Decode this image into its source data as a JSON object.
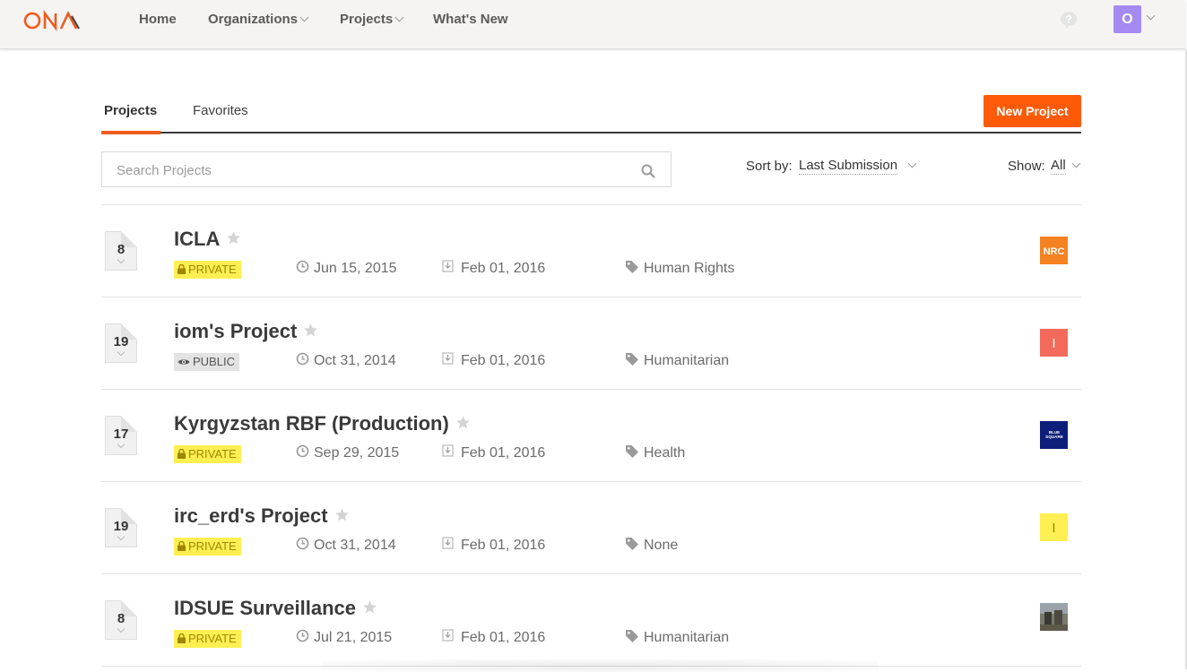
{
  "nav": {
    "items": [
      {
        "label": "Home",
        "has_dropdown": false
      },
      {
        "label": "Organizations",
        "has_dropdown": true
      },
      {
        "label": "Projects",
        "has_dropdown": true
      },
      {
        "label": "What's New",
        "has_dropdown": false
      }
    ],
    "avatar_initial": "O",
    "logo_color": "#f05b1f",
    "avatar_color": "#a48af2"
  },
  "tabs": [
    {
      "label": "Projects",
      "active": true
    },
    {
      "label": "Favorites",
      "active": false
    }
  ],
  "new_project_label": "New Project",
  "search": {
    "placeholder": "Search Projects"
  },
  "sort": {
    "label": "Sort by:",
    "value": "Last Submission"
  },
  "show": {
    "label": "Show:",
    "value": "All"
  },
  "projects": [
    {
      "count": "8",
      "title": "ICLA",
      "visibility": "PRIVATE",
      "created": "Jun 15, 2015",
      "last_submission": "Feb 01, 2016",
      "tag": "Human Rights",
      "org_logo": "NRC",
      "org_color": "#f58220"
    },
    {
      "count": "19",
      "title": "iom's Project",
      "visibility": "PUBLIC",
      "created": "Oct 31, 2014",
      "last_submission": "Feb 01, 2016",
      "tag": "Humanitarian",
      "org_logo": "I",
      "org_color": "#f36a5a"
    },
    {
      "count": "17",
      "title": "Kyrgyzstan RBF (Production)",
      "visibility": "PRIVATE",
      "created": "Sep 29, 2015",
      "last_submission": "Feb 01, 2016",
      "tag": "Health",
      "org_logo": "BLUE SQUARE",
      "org_color": "#0d1f7a"
    },
    {
      "count": "19",
      "title": "irc_erd's Project",
      "visibility": "PRIVATE",
      "created": "Oct 31, 2014",
      "last_submission": "Feb 01, 2016",
      "tag": "None",
      "org_logo": "I",
      "org_color": "#ffef52"
    },
    {
      "count": "8",
      "title": "IDSUE Surveillance",
      "visibility": "PRIVATE",
      "created": "Jul 21, 2015",
      "last_submission": "Feb 01, 2016",
      "tag": "Humanitarian",
      "org_logo": "photo",
      "org_color": "#6a6a5a"
    }
  ]
}
